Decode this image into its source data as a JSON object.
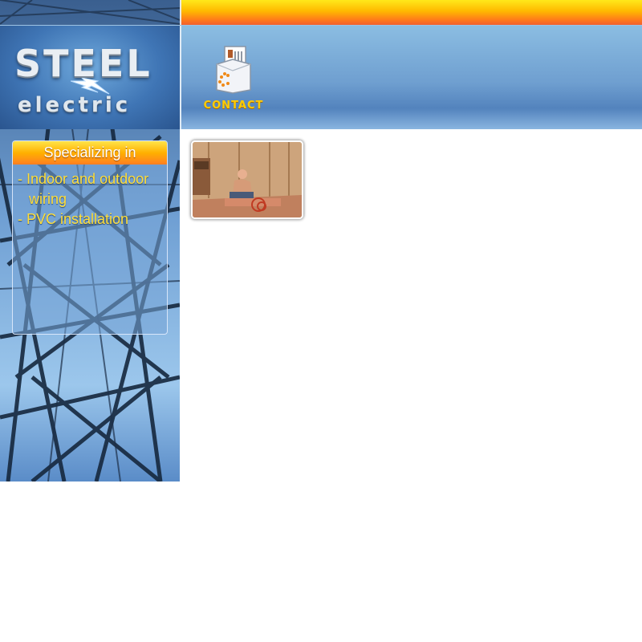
{
  "logo": {
    "line1": "STEEL",
    "line2": "electric",
    "bolt_icon": "lightning-bolt-icon"
  },
  "nav": {
    "contact_label": "CONTACT",
    "contact_icon": "mail-envelope-icon"
  },
  "specializing": {
    "title": "Specializing in",
    "items": [
      "- Indoor and outdoor wiring",
      "- PVC installation"
    ]
  },
  "photo": {
    "subject": "electrician-at-work-photo"
  },
  "colors": {
    "top_bar_yellow": "#ffe81a",
    "top_bar_orange": "#ff7a1a",
    "header_blue": "#6f9fd0",
    "spec_text": "#ffde3a",
    "contact_text": "#ffcc00"
  }
}
